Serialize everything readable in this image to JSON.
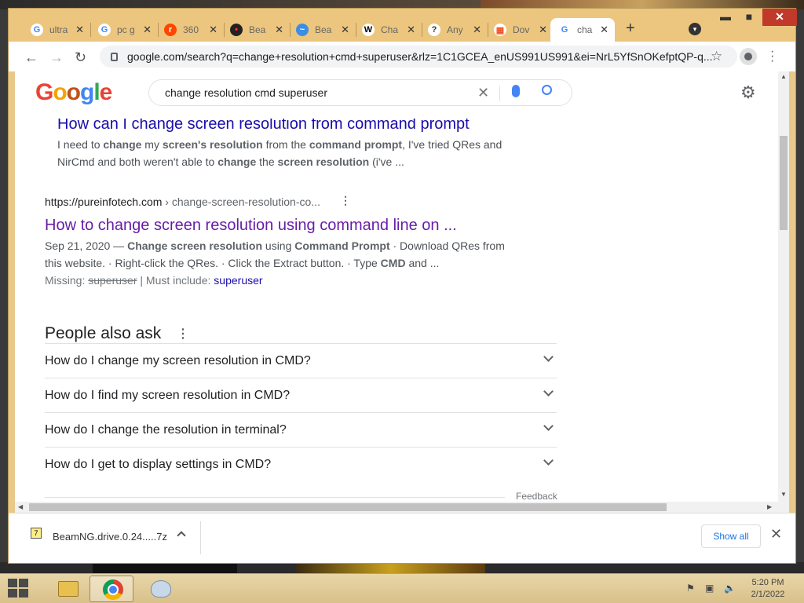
{
  "tabs": [
    {
      "label": "ultra",
      "icon": "G",
      "color": "#4285f4",
      "bg": "#fff"
    },
    {
      "label": "pc g",
      "icon": "G",
      "color": "#4285f4",
      "bg": "#fff"
    },
    {
      "label": "360",
      "icon": "r",
      "color": "#fff",
      "bg": "#ff4500"
    },
    {
      "label": "Bea",
      "icon": "•",
      "color": "#f33",
      "bg": "#222"
    },
    {
      "label": "Bea",
      "icon": "~",
      "color": "#fff",
      "bg": "#3a8ee6"
    },
    {
      "label": "Cha",
      "icon": "W",
      "color": "#000",
      "bg": "#fff"
    },
    {
      "label": "Any",
      "icon": "?",
      "color": "#333",
      "bg": "#fff"
    },
    {
      "label": "Dov",
      "icon": "▦",
      "color": "#f25022",
      "bg": "#fff"
    },
    {
      "label": "cha",
      "icon": "G",
      "color": "#4285f4",
      "bg": "#fff",
      "active": true
    }
  ],
  "omnibox": {
    "url": "google.com/search?q=change+resolution+cmd+superuser&rlz=1C1GCEA_enUS991US991&ei=NrL5YfSnOKefptQP-q..."
  },
  "search": {
    "logo": "Google",
    "query": "change resolution cmd superuser"
  },
  "results": [
    {
      "title": "How can I change screen resolution from command prompt",
      "snippet_html": "I need to <b>change</b> my <b>screen's resolution</b> from the <b>command prompt</b>, I've tried QRes and NirCmd and both weren't able to <b>change</b> the <b>screen resolution</b> (i've ..."
    },
    {
      "cite_domain": "https://pureinfotech.com",
      "cite_path": " › change-screen-resolution-co...",
      "title": "How to change screen resolution using command line on ...",
      "snippet_html": "Sep 21, 2020 — <b>Change screen resolution</b> using <b>Command Prompt</b> · Download QRes from this website. · Right-click the QRes. · Click the Extract button. · Type <b>CMD</b> and ...",
      "missing_label": "Missing: ",
      "missing_term": "superuser",
      "must_include_label": " | Must include: ",
      "must_include_term": "superuser"
    }
  ],
  "paa": {
    "title": "People also ask",
    "questions": [
      "How do I change my screen resolution in CMD?",
      "How do I find my screen resolution in CMD?",
      "How do I change the resolution in terminal?",
      "How do I get to display settings in CMD?"
    ],
    "feedback": "Feedback"
  },
  "downloads": {
    "filename": "BeamNG.drive.0.24.....7z",
    "show_all": "Show all"
  },
  "taskbar": {
    "time": "5:20 PM",
    "date": "2/1/2022"
  },
  "colors": {
    "frame": "#ecc67e",
    "link": "#1a0dab",
    "visited": "#681da8"
  }
}
